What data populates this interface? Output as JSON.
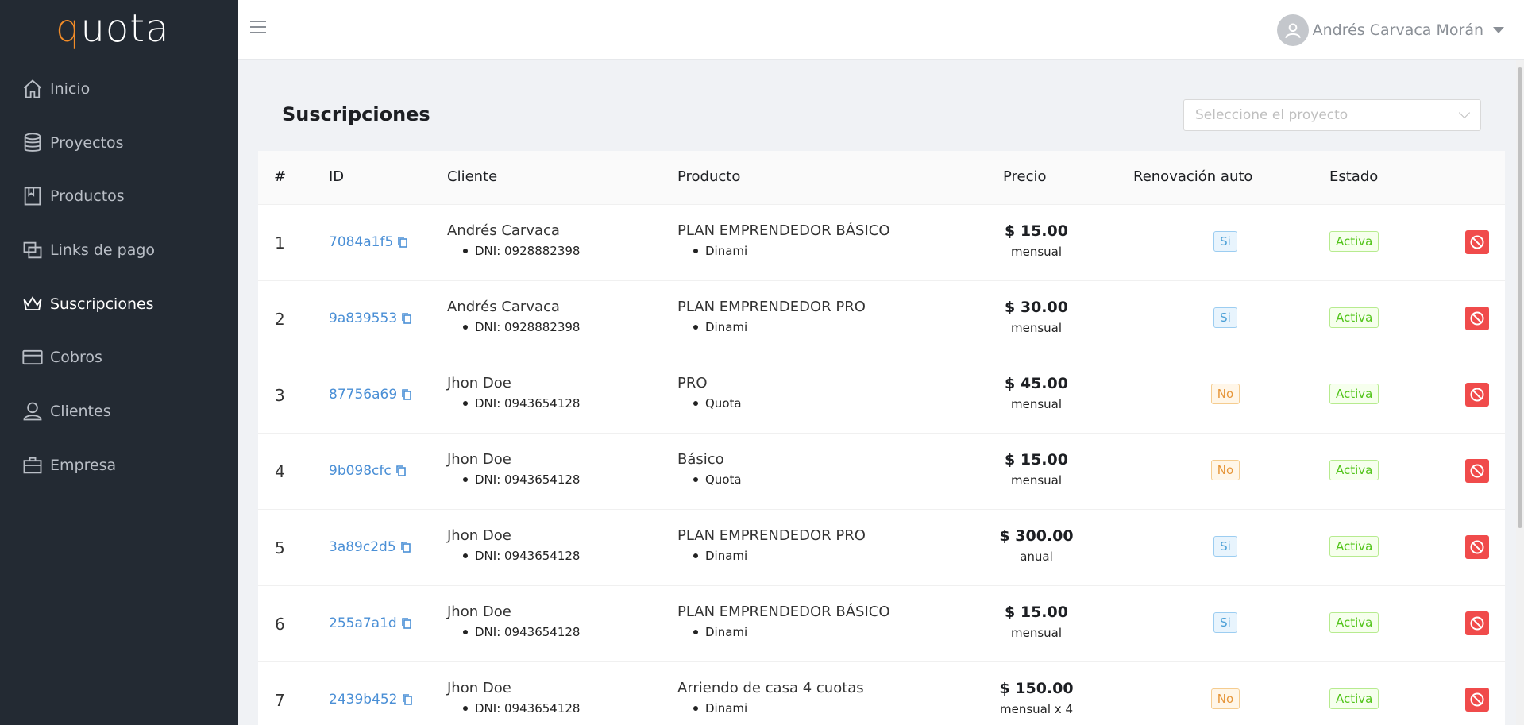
{
  "app": {
    "logo_q": "q",
    "logo_rest": "uota"
  },
  "sidebar": {
    "items": [
      {
        "label": "Inicio",
        "icon": "home-icon",
        "active": false
      },
      {
        "label": "Proyectos",
        "icon": "database-icon",
        "active": false
      },
      {
        "label": "Productos",
        "icon": "book-icon",
        "active": false
      },
      {
        "label": "Links de pago",
        "icon": "copy-windows-icon",
        "active": false
      },
      {
        "label": "Suscripciones",
        "icon": "crown-icon",
        "active": true
      },
      {
        "label": "Cobros",
        "icon": "credit-card-icon",
        "active": false
      },
      {
        "label": "Clientes",
        "icon": "user-icon",
        "active": false
      },
      {
        "label": "Empresa",
        "icon": "briefcase-icon",
        "active": false
      }
    ]
  },
  "header": {
    "user_name": "Andrés Carvaca Morán"
  },
  "main": {
    "title": "Suscripciones",
    "project_select": {
      "placeholder": "Seleccione el proyecto"
    }
  },
  "table": {
    "columns": [
      "#",
      "ID",
      "Cliente",
      "Producto",
      "Precio",
      "Renovación auto",
      "Estado"
    ],
    "rows": [
      {
        "num": "1",
        "id": "7084a1f5",
        "cliente": "Andrés Carvaca",
        "dni": "DNI: 0928882398",
        "producto": "PLAN EMPRENDEDOR BÁSICO",
        "proyecto": "Dinami",
        "precio": "$ 15.00",
        "periodo": "mensual",
        "renovacion": "Si",
        "estado": "Activa"
      },
      {
        "num": "2",
        "id": "9a839553",
        "cliente": "Andrés Carvaca",
        "dni": "DNI: 0928882398",
        "producto": "PLAN EMPRENDEDOR PRO",
        "proyecto": "Dinami",
        "precio": "$ 30.00",
        "periodo": "mensual",
        "renovacion": "Si",
        "estado": "Activa"
      },
      {
        "num": "3",
        "id": "87756a69",
        "cliente": "Jhon Doe",
        "dni": "DNI: 0943654128",
        "producto": "PRO",
        "proyecto": "Quota",
        "precio": "$ 45.00",
        "periodo": "mensual",
        "renovacion": "No",
        "estado": "Activa"
      },
      {
        "num": "4",
        "id": "9b098cfc",
        "cliente": "Jhon Doe",
        "dni": "DNI: 0943654128",
        "producto": "Básico",
        "proyecto": "Quota",
        "precio": "$ 15.00",
        "periodo": "mensual",
        "renovacion": "No",
        "estado": "Activa"
      },
      {
        "num": "5",
        "id": "3a89c2d5",
        "cliente": "Jhon Doe",
        "dni": "DNI: 0943654128",
        "producto": "PLAN EMPRENDEDOR PRO",
        "proyecto": "Dinami",
        "precio": "$ 300.00",
        "periodo": "anual",
        "renovacion": "Si",
        "estado": "Activa"
      },
      {
        "num": "6",
        "id": "255a7a1d",
        "cliente": "Jhon Doe",
        "dni": "DNI: 0943654128",
        "producto": "PLAN EMPRENDEDOR BÁSICO",
        "proyecto": "Dinami",
        "precio": "$ 15.00",
        "periodo": "mensual",
        "renovacion": "Si",
        "estado": "Activa"
      },
      {
        "num": "7",
        "id": "2439b452",
        "cliente": "Jhon Doe",
        "dni": "DNI: 0943654128",
        "producto": "Arriendo de casa 4 cuotas",
        "proyecto": "Dinami",
        "precio": "$ 150.00",
        "periodo": "mensual x 4",
        "renovacion": "No",
        "estado": "Activa"
      }
    ]
  },
  "colors": {
    "sidebar_bg": "#232a33",
    "accent": "#f28c28",
    "link": "#4a8fd6",
    "danger": "#f04b4b"
  }
}
